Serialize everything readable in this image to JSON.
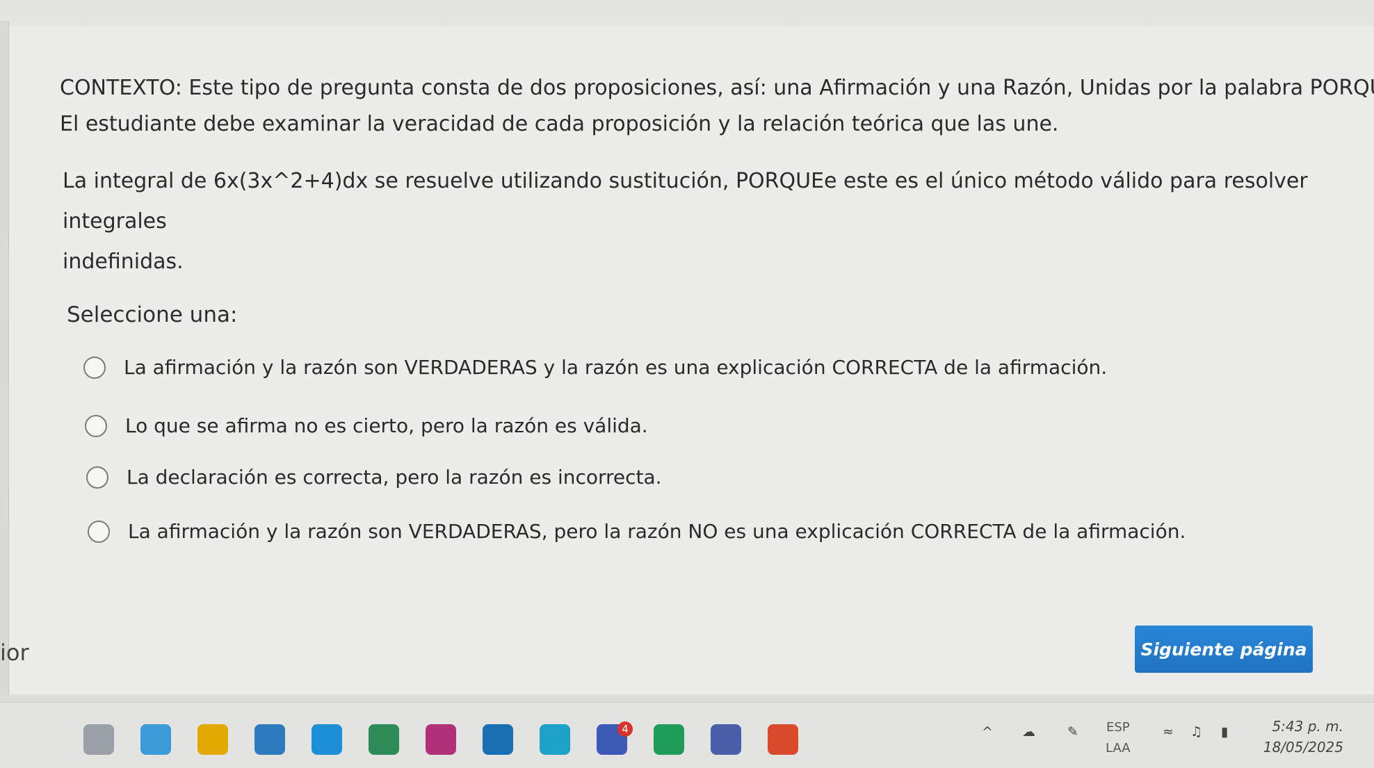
{
  "context": {
    "line1": "CONTEXTO: Este tipo de pregunta consta de dos proposiciones, así: una Afirmación y una Razón, Unidas por la palabra PORQUÉ.",
    "line2": "El estudiante debe examinar la veracidad de cada proposición y la relación teórica que las une."
  },
  "question": {
    "prefix": "La integral de ",
    "math": "6x(3x^2+4)dx",
    "suffix": " se resuelve utilizando sustitución, PORQUEe este es el único método válido para resolver integrales",
    "line2": "indefinidas."
  },
  "prompt": "Seleccione una:",
  "options": [
    {
      "label": "La afirmación y la razón son VERDADERAS y la razón es una explicación CORRECTA de la afirmación.",
      "selected": false
    },
    {
      "label": "Lo que se afirma no es cierto, pero la razón es válida.",
      "selected": false
    },
    {
      "label": "La declaración es correcta, pero la razón es incorrecta.",
      "selected": false
    },
    {
      "label": "La afirmación y la razón son VERDADERAS, pero la razón NO es una explicación CORRECTA de la afirmación.",
      "selected": false
    }
  ],
  "nav": {
    "prev_label": "ior",
    "next_label": "Siguiente página"
  },
  "taskbar": {
    "icons": [
      {
        "name": "app-icon-1",
        "color": "#9aa0a6"
      },
      {
        "name": "app-icon-2",
        "color": "#3a9bd8"
      },
      {
        "name": "app-icon-3",
        "color": "#e0a800"
      },
      {
        "name": "app-icon-4",
        "color": "#2f7bbf"
      },
      {
        "name": "app-icon-5",
        "color": "#1c8fd6"
      },
      {
        "name": "app-icon-6",
        "color": "#2e8b57"
      },
      {
        "name": "app-icon-7",
        "color": "#b0307a"
      },
      {
        "name": "app-icon-8",
        "color": "#1a6fb3"
      },
      {
        "name": "app-icon-9",
        "color": "#1da1c8"
      },
      {
        "name": "app-icon-10",
        "color": "#3b5bb5"
      },
      {
        "name": "app-icon-11",
        "color": "#1f9c5a"
      },
      {
        "name": "app-icon-12",
        "color": "#4b5fa8"
      },
      {
        "name": "app-icon-13",
        "color": "#d84a2b"
      }
    ],
    "badge": "4",
    "lang_top": "ESP",
    "lang_bottom": "LAA",
    "time": "5:43 p. m.",
    "date": "18/05/2025"
  }
}
